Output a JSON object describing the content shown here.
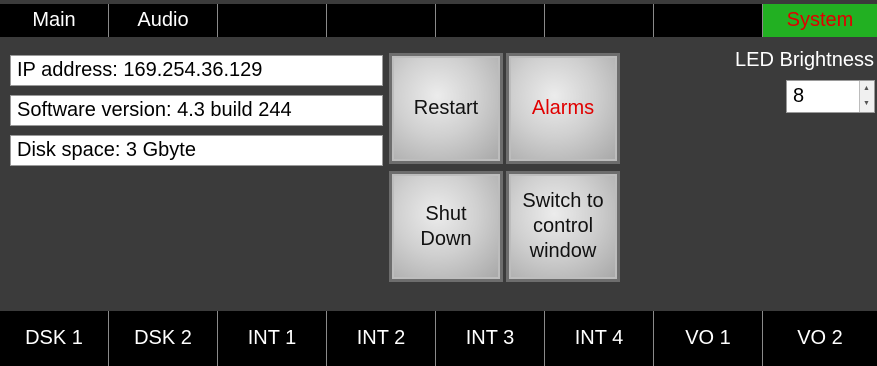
{
  "top_tabs": [
    {
      "label": "Main"
    },
    {
      "label": "Audio"
    },
    {
      "label": ""
    },
    {
      "label": ""
    },
    {
      "label": ""
    },
    {
      "label": ""
    },
    {
      "label": ""
    },
    {
      "label": "System",
      "active": true
    }
  ],
  "info": {
    "ip": "IP address: 169.254.36.129",
    "software": "Software version: 4.3 build 244",
    "disk": "Disk space: 3 Gbyte"
  },
  "buttons": {
    "restart": "Restart",
    "alarms": "Alarms",
    "shutdown_line1": "Shut",
    "shutdown_line2": "Down",
    "switch_line1": "Switch to",
    "switch_line2": "control",
    "switch_line3": "window"
  },
  "led": {
    "label": "LED Brightness",
    "value": "8"
  },
  "bottom_tabs": [
    {
      "label": "DSK 1"
    },
    {
      "label": "DSK 2"
    },
    {
      "label": "INT 1"
    },
    {
      "label": "INT 2"
    },
    {
      "label": "INT 3"
    },
    {
      "label": "INT 4"
    },
    {
      "label": "VO 1"
    },
    {
      "label": "VO 2"
    }
  ],
  "colors": {
    "background": "#3b3b3b",
    "active_tab_bg": "#22b022",
    "alert_text": "#e00000"
  }
}
